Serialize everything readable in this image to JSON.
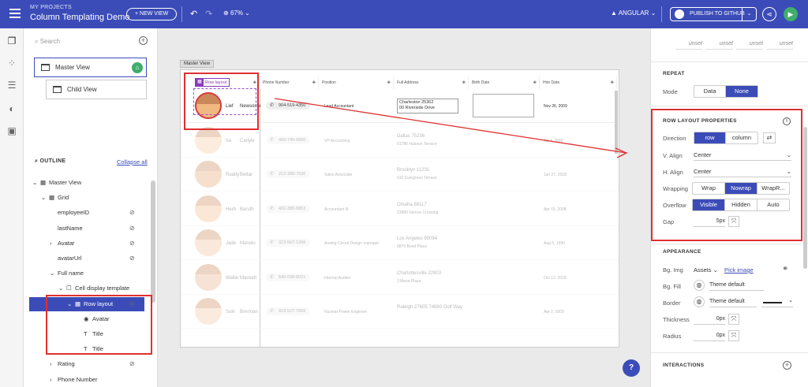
{
  "topbar": {
    "section": "MY PROJECTS",
    "title": "Column Templating Demo",
    "new_view": "+ NEW VIEW",
    "zoom": "67%",
    "framework": "ANGULAR",
    "publish": "PUBLISH TO GITHUB"
  },
  "left": {
    "search_placeholder": "Search",
    "views": [
      "Master View",
      "Child View"
    ],
    "outline_title": "OUTLINE",
    "collapse_all": "Collapse all",
    "tree": [
      {
        "label": "Master View",
        "indent": 0,
        "chev": "⌄",
        "icon": "▦",
        "eye": false
      },
      {
        "label": "Grid",
        "indent": 1,
        "chev": "⌄",
        "icon": "▦",
        "eye": false
      },
      {
        "label": "employeeID",
        "indent": 2,
        "chev": "",
        "icon": "",
        "eye": true
      },
      {
        "label": "lastName",
        "indent": 2,
        "chev": "",
        "icon": "",
        "eye": true
      },
      {
        "label": "Avatar",
        "indent": 2,
        "chev": "›",
        "icon": "",
        "eye": true
      },
      {
        "label": "avatarUrl",
        "indent": 2,
        "chev": "",
        "icon": "",
        "eye": true
      },
      {
        "label": "Full name",
        "indent": 2,
        "chev": "⌄",
        "icon": "",
        "eye": false
      },
      {
        "label": "Cell display template",
        "indent": 3,
        "chev": "⌄",
        "icon": "☐",
        "eye": false
      },
      {
        "label": "Row layout",
        "indent": 4,
        "chev": "⌄",
        "icon": "▦",
        "eye": true,
        "selected": true
      },
      {
        "label": "Avatar",
        "indent": 5,
        "chev": "",
        "icon": "◉",
        "eye": false
      },
      {
        "label": "Title",
        "indent": 5,
        "chev": "",
        "icon": "T",
        "eye": false
      },
      {
        "label": "Title",
        "indent": 5,
        "chev": "",
        "icon": "T",
        "eye": false
      },
      {
        "label": "Rating",
        "indent": 2,
        "chev": "›",
        "icon": "",
        "eye": true
      },
      {
        "label": "Phone Number",
        "indent": 2,
        "chev": "›",
        "icon": "",
        "eye": false
      }
    ]
  },
  "canvas": {
    "view_label": "Master View",
    "row_layout_badge": "Row layout",
    "columns": [
      "Phone Number",
      "Position",
      "Full Address",
      "Birth Date",
      "Hire Date"
    ],
    "rows": [
      {
        "first": "Lief",
        "last": "Newsome",
        "phone": "904-519-4350",
        "position": "Lead Accountant",
        "addr1": "Charleston 25362",
        "addr2": "00 Riverside Drive",
        "hire": "Nov 26, 2009"
      },
      {
        "first": "Ira",
        "last": "Carlyle",
        "phone": "469-749-9890",
        "position": "VP Accounting",
        "addr1": "Dallas 75236",
        "addr2": "01786 Hudson Terrace",
        "hire": "Jul 4, 2009"
      },
      {
        "first": "Ruddy",
        "last": "Bettar",
        "phone": "212-380-7036",
        "position": "Sales Associate",
        "addr1": "Brooklyn 11231",
        "addr2": "610 Evergreen Terrace",
        "hire": "Jun 27, 2018"
      },
      {
        "first": "Herb",
        "last": "Baruth",
        "phone": "402-380-9852",
        "position": "Accountant III",
        "addr1": "Omaha 68117",
        "addr2": "23880 Vernon Crossing",
        "hire": "Apr 15, 2008"
      },
      {
        "first": "Jade",
        "last": "Manolo",
        "phone": "323-567-1266",
        "position": "Analog Circuit Design manager",
        "addr1": "Los Angeles 90094",
        "addr2": "6870 Bond Place",
        "hire": "Aug 5, 1990"
      },
      {
        "first": "Wallie",
        "last": "Mackett",
        "phone": "540-638-8021",
        "position": "Internal Auditor",
        "addr1": "Charlottesville 22903",
        "addr2": "3 Mesa Plaza",
        "hire": "Oct 12, 2018"
      },
      {
        "first": "Suki",
        "last": "Brennan",
        "phone": "919-527-7666",
        "position": "Nuclear Power Engineer",
        "addr1": "Raleigh 27605 74880 Golf Way",
        "addr2": "",
        "hire": "Apr 2, 2009"
      }
    ],
    "help": "?"
  },
  "right": {
    "unset": [
      "unset",
      "unset",
      "unset",
      "unset"
    ],
    "repeat_title": "REPEAT",
    "mode_label": "Mode",
    "mode_options": [
      "Data",
      "None"
    ],
    "rlp_title": "ROW LAYOUT PROPERTIES",
    "direction_label": "Direction",
    "direction_options": [
      "row",
      "column"
    ],
    "valign_label": "V. Align",
    "valign_value": "Center",
    "halign_label": "H. Align",
    "halign_value": "Center",
    "wrapping_label": "Wrapping",
    "wrapping_options": [
      "Wrap",
      "Nowrap",
      "WrapR..."
    ],
    "overflow_label": "Overflow",
    "overflow_options": [
      "Visible",
      "Hidden",
      "Auto"
    ],
    "gap_label": "Gap",
    "gap_value": "5px",
    "appearance_title": "APPEARANCE",
    "bgimg_label": "Bg. Img",
    "bgimg_value": "Assets",
    "pick_image": "Pick image",
    "bgfill_label": "Bg. Fill",
    "bgfill_value": "Theme default",
    "border_label": "Border",
    "border_value": "Theme default",
    "thickness_label": "Thickness",
    "thickness_value": "0px",
    "radius_label": "Radius",
    "radius_value": "0px",
    "interactions_title": "INTERACTIONS"
  },
  "colors": {
    "accent": "#3b4cb8",
    "highlight": "#e03030",
    "success": "#3fae6a"
  }
}
